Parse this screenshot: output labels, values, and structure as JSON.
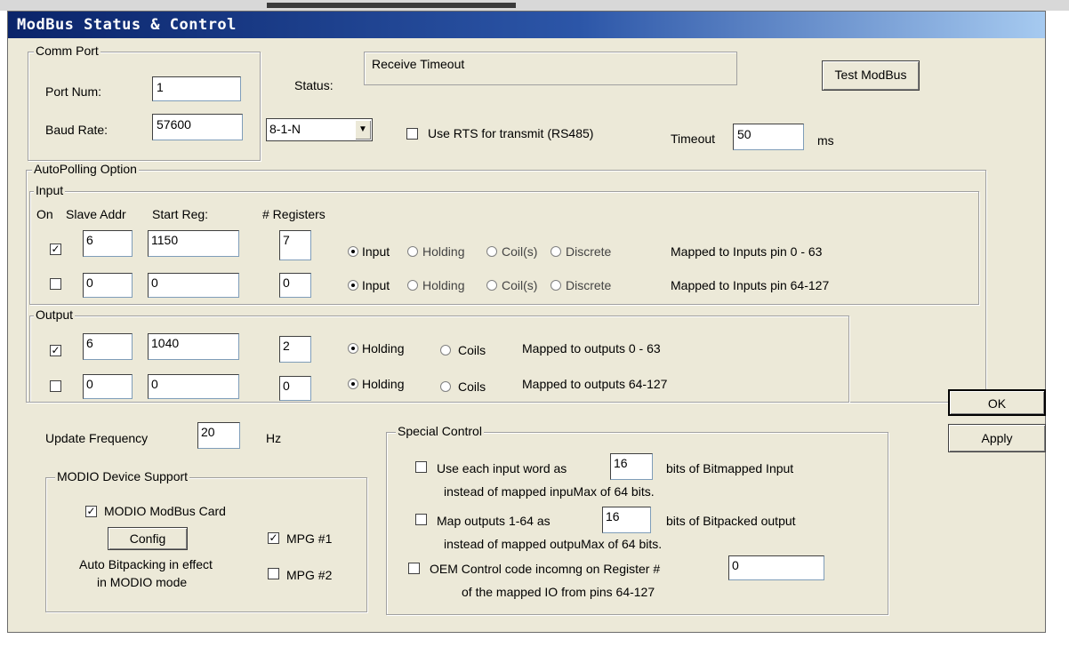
{
  "window": {
    "title": "ModBus Status & Control"
  },
  "comm_port": {
    "group_label": "Comm Port",
    "port_num_label": "Port Num:",
    "port_num": "1",
    "baud_rate_label": "Baud Rate:",
    "baud_rate": "57600",
    "format": "8-1-N",
    "status_label": "Status:",
    "status_text": "Receive Timeout",
    "test_button": "Test ModBus",
    "rts_label": "Use RTS for transmit (RS485)",
    "rts_checked": false,
    "timeout_label": "Timeout",
    "timeout_value": "50",
    "timeout_unit": "ms"
  },
  "autopolling": {
    "group_label": "AutoPolling Option",
    "input": {
      "group_label": "Input",
      "headers": [
        "On",
        "Slave Addr",
        "Start Reg:",
        "# Registers"
      ],
      "rows": [
        {
          "on": true,
          "slave": "6",
          "start": "1150",
          "count": "7",
          "type": "Input",
          "mapped": "Mapped to Inputs pin 0 - 63"
        },
        {
          "on": false,
          "slave": "0",
          "start": "0",
          "count": "0",
          "type": "Input",
          "mapped": "Mapped to Inputs pin 64-127"
        }
      ],
      "type_options": [
        "Input",
        "Holding",
        "Coil(s)",
        "Discrete"
      ]
    },
    "output": {
      "group_label": "Output",
      "rows": [
        {
          "on": true,
          "slave": "6",
          "start": "1040",
          "count": "2",
          "type": "Holding",
          "mapped": "Mapped to outputs 0 - 63"
        },
        {
          "on": false,
          "slave": "0",
          "start": "0",
          "count": "0",
          "type": "Holding",
          "mapped": "Mapped to outputs 64-127"
        }
      ],
      "type_options": [
        "Holding",
        "Coils"
      ]
    }
  },
  "update": {
    "label": "Update Frequency",
    "value": "20",
    "unit": "Hz"
  },
  "modio": {
    "group_label": "MODIO Device Support",
    "card_label": "MODIO ModBus Card",
    "card_checked": true,
    "config_button": "Config",
    "mpg1_label": "MPG #1",
    "mpg1_checked": true,
    "mpg2_label": "MPG #2",
    "mpg2_checked": false,
    "note_line1": "Auto Bitpacking in effect",
    "note_line2": "in MODIO mode"
  },
  "special": {
    "group_label": "Special Control",
    "opt1_prefix": "Use each input word as",
    "opt1_value": "16",
    "opt1_suffix": "bits of Bitmapped Input",
    "opt1_line2": "instead of mapped inpuMax of 64 bits.",
    "opt2_prefix": "Map outputs 1-64 as",
    "opt2_value": "16",
    "opt2_suffix": "bits of Bitpacked output",
    "opt2_line2": "instead of mapped outpuMax of 64 bits.",
    "opt3_prefix": "OEM Control code incomng on Register #",
    "opt3_value": "0",
    "opt3_line2": "of the mapped IO from pins 64-127"
  },
  "buttons": {
    "ok": "OK",
    "apply": "Apply"
  }
}
